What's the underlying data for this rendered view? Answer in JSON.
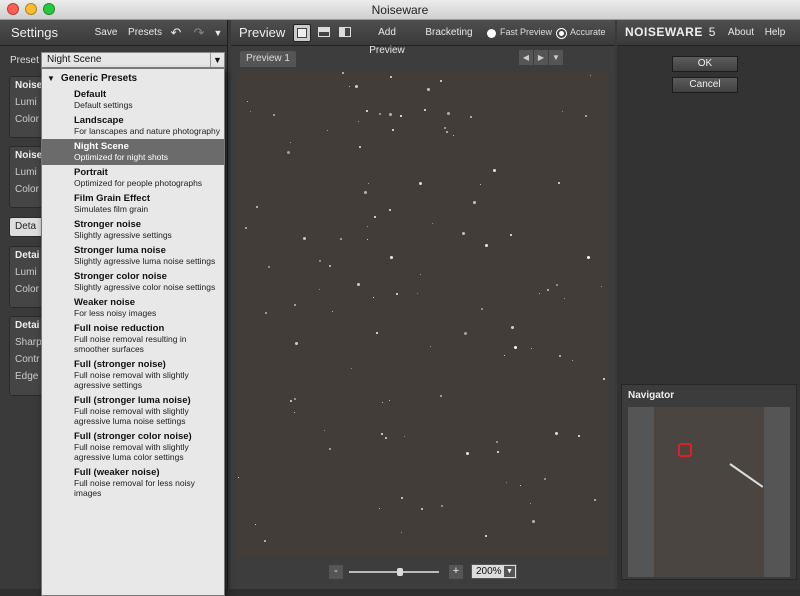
{
  "window": {
    "title": "Noiseware"
  },
  "settings": {
    "title": "Settings",
    "save_label": "Save",
    "presets_label": "Presets",
    "preset_label": "Preset",
    "preset_value": "Night Scene",
    "sections": [
      {
        "title": "Noise",
        "rows": [
          "Lumi",
          "Color"
        ]
      },
      {
        "title": "Noise",
        "rows": [
          "Lumi",
          "Color"
        ]
      },
      {
        "title": "Deta",
        "rows": []
      },
      {
        "title": "Detai",
        "rows": [
          "Lumi",
          "Color"
        ]
      },
      {
        "title": "Detai",
        "rows": [
          "Sharp",
          "Contr",
          "Edge"
        ]
      }
    ]
  },
  "dropdown": {
    "group": "Generic Presets",
    "items": [
      {
        "name": "Default",
        "desc": "Default settings"
      },
      {
        "name": "Landscape",
        "desc": "For lanscapes and nature photography"
      },
      {
        "name": "Night Scene",
        "desc": "Optimized for night shots"
      },
      {
        "name": "Portrait",
        "desc": "Optimized for people photographs"
      },
      {
        "name": "Film Grain Effect",
        "desc": "Simulates film grain"
      },
      {
        "name": "Stronger noise",
        "desc": "Slightly agressive settings"
      },
      {
        "name": "Stronger luma noise",
        "desc": "Slightly agressive luma noise settings"
      },
      {
        "name": "Stronger color noise",
        "desc": "Slightly agressive color noise settings"
      },
      {
        "name": "Weaker noise",
        "desc": "For less noisy images"
      },
      {
        "name": "Full noise reduction",
        "desc": "Full noise removal resulting in smoother surfaces"
      },
      {
        "name": "Full (stronger noise)",
        "desc": "Full noise removal with slightly agressive settings"
      },
      {
        "name": "Full (stronger luma noise)",
        "desc": "Full noise removal with slightly agressive luma noise settings"
      },
      {
        "name": "Full (stronger color noise)",
        "desc": "Full noise removal with slightly agressive luma color settings"
      },
      {
        "name": "Full (weaker noise)",
        "desc": "Full noise removal for less noisy images"
      }
    ]
  },
  "preview": {
    "title": "Preview",
    "add_preview": "Add Preview",
    "bracketing": "Bracketing",
    "fast_preview": "Fast Preview",
    "accurate": "Accurate",
    "tab": "Preview 1",
    "zoom_minus": "-",
    "zoom_plus": "+",
    "zoom": "200%"
  },
  "right": {
    "brand": "NOISEWARE",
    "version": "5",
    "about": "About",
    "help": "Help",
    "ok": "OK",
    "cancel": "Cancel",
    "navigator": "Navigator"
  }
}
